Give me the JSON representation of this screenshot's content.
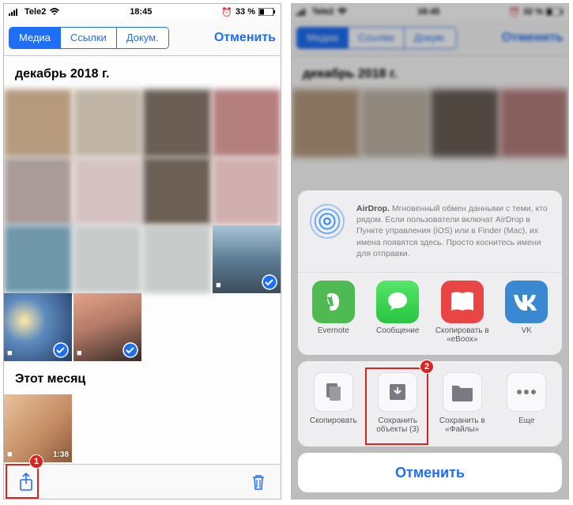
{
  "status": {
    "carrier": "Tele2",
    "time": "18:45",
    "left_battery": "33 %",
    "right_battery": "32 %",
    "alarm_glyph": "⏰"
  },
  "nav": {
    "segments": [
      "Медиа",
      "Ссылки",
      "Докум."
    ],
    "active_index": 0,
    "cancel": "Отменить"
  },
  "sections": {
    "december": "декабрь 2018 г.",
    "this_month": "Этот месяц"
  },
  "media": {
    "this_month_dur": "1:38"
  },
  "airdrop": {
    "title": "AirDrop.",
    "body": "Мгновенный обмен данными с теми, кто рядом. Если пользователи включат AirDrop в Пункте управления (iOS) или в Finder (Mac), их имена появятся здесь. Просто коснитесь имени для отправки."
  },
  "share_apps": [
    {
      "name": "Evernote",
      "bg": "#4fba52"
    },
    {
      "name": "Сообщение",
      "bg": "#37d24c"
    },
    {
      "name": "Скопировать в «eBoox»",
      "bg": "#e94545"
    },
    {
      "name": "VK",
      "bg": "#3b88d2"
    }
  ],
  "actions": [
    {
      "name": "Скопировать"
    },
    {
      "name": "Сохранить объекты (3)"
    },
    {
      "name": "Сохранить в «Файлы»"
    },
    {
      "name": "Еще"
    }
  ],
  "sheet_cancel": "Отменить",
  "annotations": {
    "one": "1",
    "two": "2"
  }
}
